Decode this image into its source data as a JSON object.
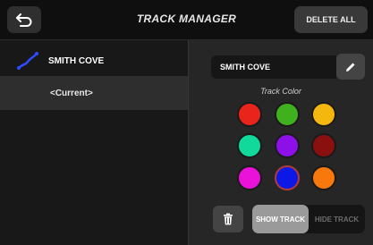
{
  "header": {
    "title": "TRACK MANAGER",
    "delete_all_label": "DELETE ALL",
    "back_icon": "back-arrow-icon"
  },
  "tracks": [
    {
      "name": "SMITH COVE",
      "icon": "track-path-icon",
      "color": "#2d4bff"
    },
    {
      "name": "<Current>"
    }
  ],
  "detail": {
    "name_value": "SMITH COVE",
    "edit_icon": "pencil-icon",
    "track_color_label": "Track Color",
    "colors": [
      "#e8241c",
      "#3fb11f",
      "#f4b70f",
      "#11d99c",
      "#8d10e8",
      "#8a1010",
      "#ea11d8",
      "#0b18e6",
      "#f7780d"
    ],
    "selected_color": "#0b18e6",
    "trash_icon": "trash-icon",
    "show_label": "SHOW TRACK",
    "hide_label": "HIDE TRACK",
    "show_selected": true
  }
}
